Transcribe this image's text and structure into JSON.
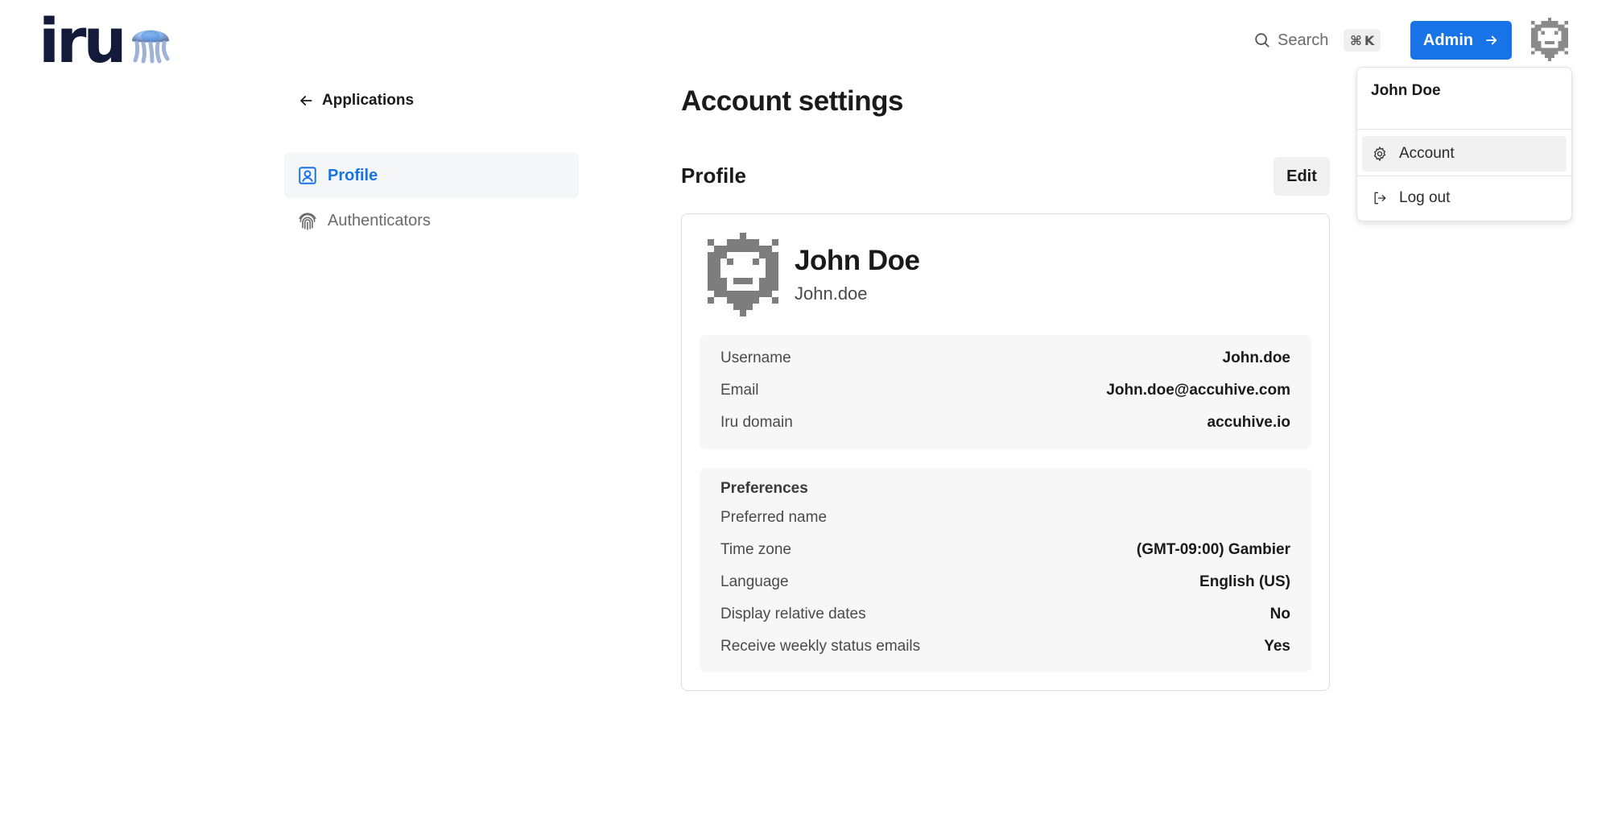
{
  "header": {
    "logo_text": "iru",
    "search_label": "Search",
    "shortcut_symbol": "⌘",
    "shortcut_key": "K",
    "admin_label": "Admin",
    "accent_color": "#1773e6"
  },
  "user_menu": {
    "name": "John Doe",
    "items": [
      {
        "label": "Account",
        "icon": "gear-icon",
        "active": true
      },
      {
        "label": "Log out",
        "icon": "logout-icon",
        "active": false
      }
    ]
  },
  "sidebar": {
    "back_label": "Applications",
    "items": [
      {
        "label": "Profile",
        "icon": "user-square-icon",
        "active": true
      },
      {
        "label": "Authenticators",
        "icon": "fingerprint-icon",
        "active": false
      }
    ]
  },
  "main": {
    "title": "Account settings",
    "section_title": "Profile",
    "edit_label": "Edit",
    "profile": {
      "name": "John Doe",
      "handle": "John.doe"
    },
    "details": [
      {
        "label": "Username",
        "value": "John.doe"
      },
      {
        "label": "Email",
        "value": "John.doe@accuhive.com"
      },
      {
        "label": "Iru domain",
        "value": "accuhive.io"
      }
    ],
    "preferences": {
      "heading": "Preferences",
      "rows": [
        {
          "label": "Preferred name",
          "value": ""
        },
        {
          "label": "Time zone",
          "value": "(GMT-09:00) Gambier"
        },
        {
          "label": "Language",
          "value": "English (US)"
        },
        {
          "label": "Display relative dates",
          "value": "No"
        },
        {
          "label": "Receive weekly status emails",
          "value": "Yes"
        }
      ]
    }
  }
}
